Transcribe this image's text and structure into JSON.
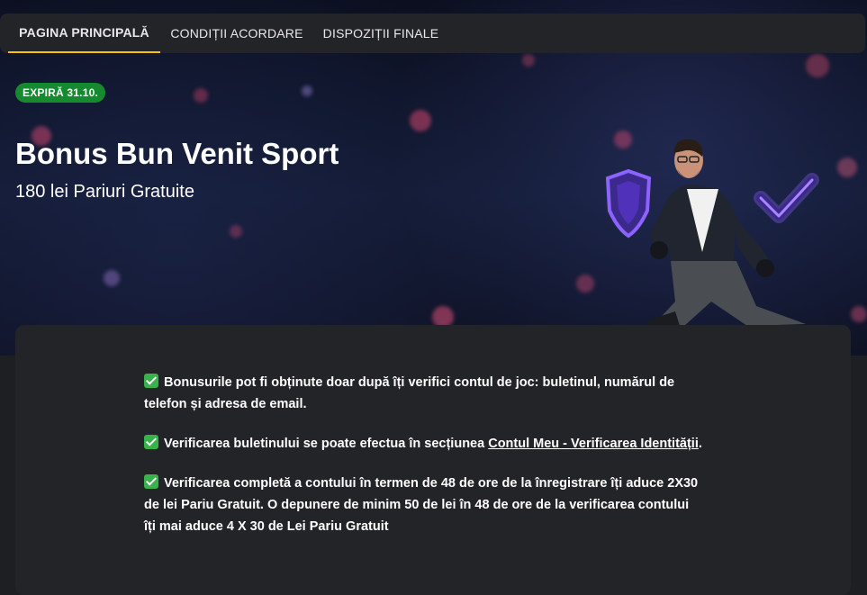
{
  "nav": {
    "tabs": [
      {
        "label": "PAGINA PRINCIPALĂ",
        "active": true
      },
      {
        "label": "CONDIȚII ACORDARE",
        "active": false
      },
      {
        "label": "DISPOZIȚII FINALE",
        "active": false
      }
    ],
    "accent_color": "#f5c400"
  },
  "hero": {
    "badge": "EXPIRĂ 31.10.",
    "badge_color": "#158a2e",
    "title": "Bonus Bun Venit Sport",
    "subtitle": "180 lei Pariuri Gratuite",
    "icons": [
      "shield-icon",
      "checkmark-icon"
    ]
  },
  "content": {
    "check_icon": "check-box-icon",
    "check_color": "#38b24a",
    "paragraphs": [
      {
        "text": "Bonusurile pot fi obținute doar după îți verifici contul de joc: buletinul, numărul de telefon și adresa de email."
      },
      {
        "text_before": "Verificarea buletinului se poate efectua în secțiunea ",
        "link": "Contul Meu - Verificarea Identității",
        "text_after": "."
      },
      {
        "text": "Verificarea completă a contului în termen de 48 de ore de la înregistrare îți aduce 2X30 de lei Pariu Gratuit. O depunere de minim 50 de lei în 48 de ore de la verificarea contului îți mai aduce 4 X 30 de Lei Pariu Gratuit"
      }
    ]
  }
}
